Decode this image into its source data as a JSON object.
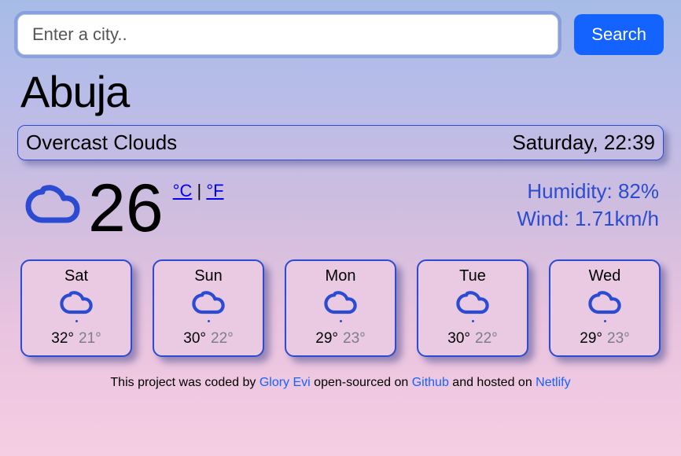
{
  "search": {
    "placeholder": "Enter a city..",
    "button": "Search"
  },
  "city": "Abuja",
  "condition": "Overcast Clouds",
  "datetime": "Saturday, 22:39",
  "temperature": "26",
  "units": {
    "c": "°C",
    "sep": " | ",
    "f": "°F"
  },
  "stats": {
    "humidity_label": "Humidity: ",
    "humidity": "82%",
    "wind_label": "Wind: ",
    "wind": "1.71km/h"
  },
  "forecast": [
    {
      "day": "Sat",
      "hi": "32°",
      "lo": "21°"
    },
    {
      "day": "Sun",
      "hi": "30°",
      "lo": "22°"
    },
    {
      "day": "Mon",
      "hi": "29°",
      "lo": "23°"
    },
    {
      "day": "Tue",
      "hi": "30°",
      "lo": "22°"
    },
    {
      "day": "Wed",
      "hi": "29°",
      "lo": "23°"
    }
  ],
  "footer": {
    "t1": "This project was coded by ",
    "l1": "Glory Evi",
    "t2": " open-sourced on ",
    "l2": "Github",
    "t3": " and hosted on ",
    "l3": "Netlify"
  }
}
